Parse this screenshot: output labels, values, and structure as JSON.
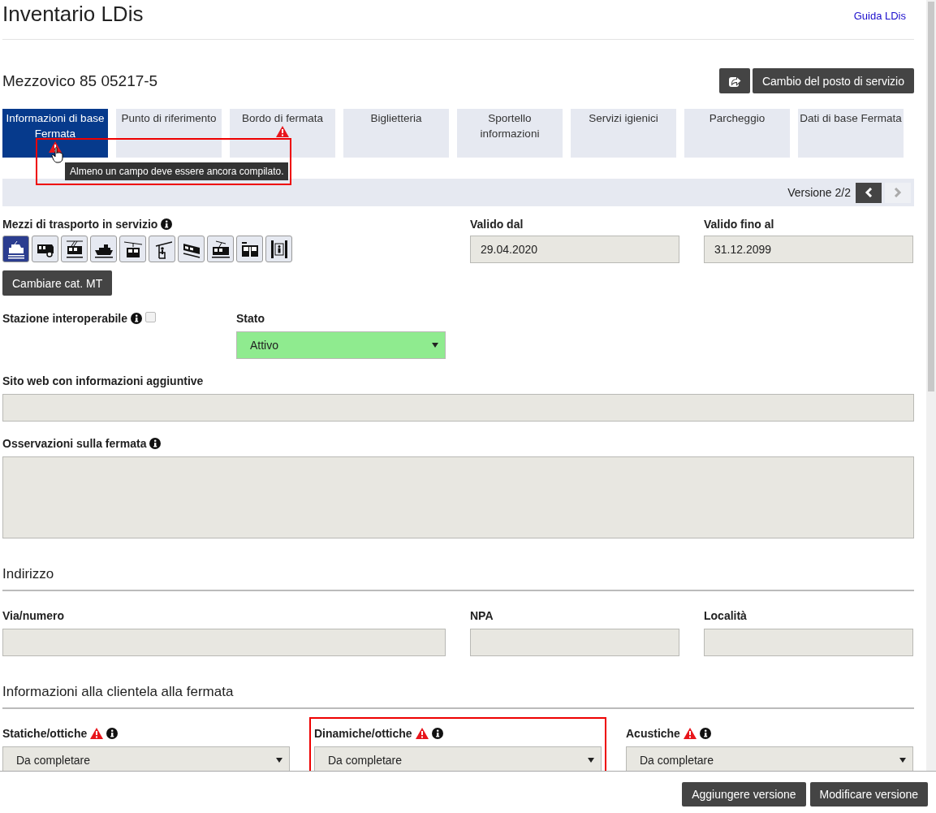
{
  "title": "Inventario LDis",
  "help_link": "Guida LDis",
  "station": "Mezzovico 85 05217-5",
  "change_button": "Cambio del posto di servizio",
  "tabs": [
    {
      "label": "Informazioni di base Fermata",
      "selected": true,
      "warning": true
    },
    {
      "label": "Punto di riferimento",
      "selected": false,
      "warning": false
    },
    {
      "label": "Bordo di fermata",
      "selected": false,
      "warning": true
    },
    {
      "label": "Biglietteria",
      "selected": false,
      "warning": false
    },
    {
      "label": "Sportello informazioni",
      "selected": false,
      "warning": false
    },
    {
      "label": "Servizi igienici",
      "selected": false,
      "warning": false
    },
    {
      "label": "Parcheggio",
      "selected": false,
      "warning": false
    },
    {
      "label": "Dati di base Fermata",
      "selected": false,
      "warning": false
    }
  ],
  "tooltip": {
    "text": "Almeno un campo deve essere ancora compilato.",
    "highlighted": true
  },
  "version": {
    "label": "Versione 2/2",
    "prev_disabled": false,
    "next_disabled": true
  },
  "transport": {
    "label": "Mezzi di trasporto in servizio",
    "button": "Cambiare cat. MT",
    "modes": [
      {
        "kind": "train",
        "selected": true
      },
      {
        "kind": "bus",
        "selected": false
      },
      {
        "kind": "trolleybus",
        "selected": false
      },
      {
        "kind": "boat",
        "selected": false
      },
      {
        "kind": "cablecar",
        "selected": false
      },
      {
        "kind": "chairlift",
        "selected": false
      },
      {
        "kind": "funicular",
        "selected": false
      },
      {
        "kind": "tram",
        "selected": false
      },
      {
        "kind": "metro",
        "selected": false
      },
      {
        "kind": "elevator",
        "selected": false
      }
    ]
  },
  "valid_from": {
    "label": "Valido dal",
    "value": "29.04.2020"
  },
  "valid_to": {
    "label": "Valido fino al",
    "value": "31.12.2099"
  },
  "interoperable": {
    "label": "Stazione interoperabile",
    "checked": false
  },
  "status": {
    "label": "Stato",
    "value": "Attivo"
  },
  "website": {
    "label": "Sito web con informazioni aggiuntive"
  },
  "remarks": {
    "label": "Osservazioni sulla fermata"
  },
  "address": {
    "title": "Indirizzo",
    "fields": [
      {
        "label": "Via/numero",
        "kind": "wide"
      },
      {
        "label": "NPA",
        "kind": "narrow"
      },
      {
        "label": "Località",
        "kind": "narrow"
      }
    ]
  },
  "customer_info": {
    "title": "Informazioni alla clientela alla fermata",
    "fields": [
      {
        "label": "Statiche/ottiche",
        "value": "Da completare",
        "warning": true,
        "highlighted": false
      },
      {
        "label": "Dinamiche/ottiche",
        "value": "Da completare",
        "warning": true,
        "highlighted": true
      },
      {
        "label": "Acustiche",
        "value": "Da completare",
        "warning": true,
        "highlighted": false
      }
    ]
  },
  "footer_buttons": [
    "Aggiungere versione",
    "Modificare versione"
  ]
}
